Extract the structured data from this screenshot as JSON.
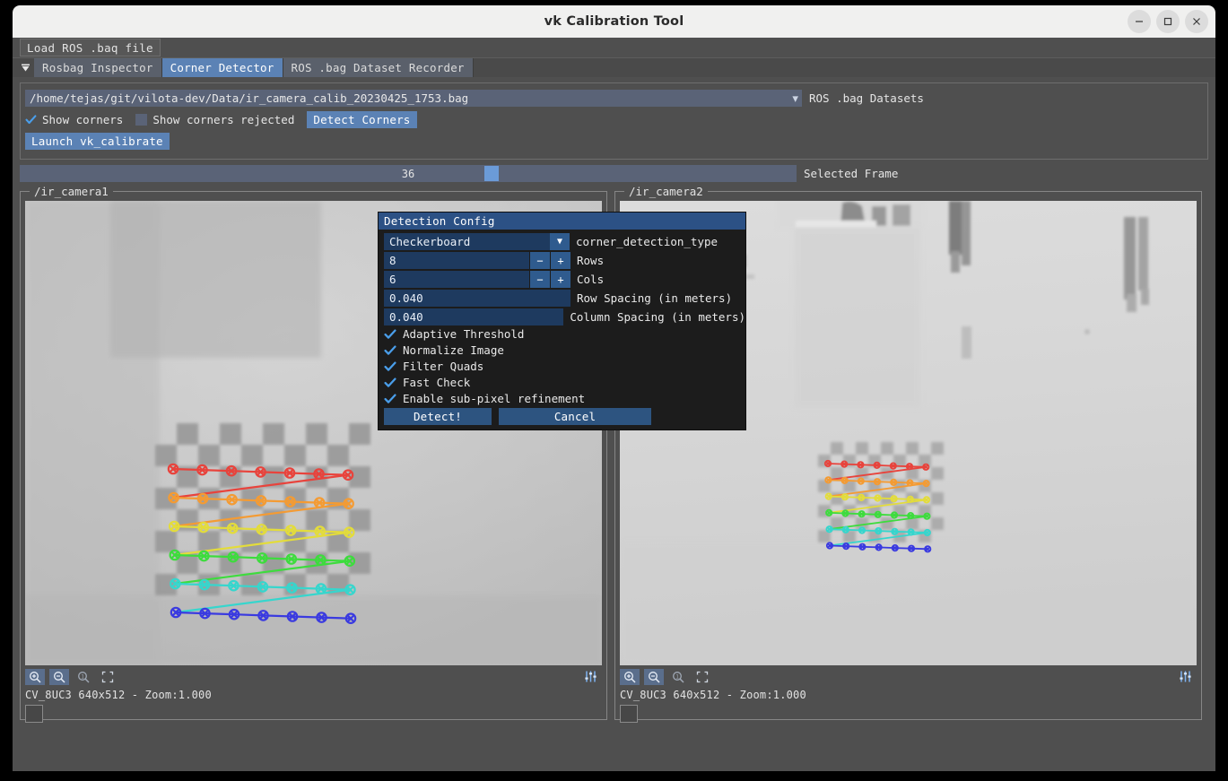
{
  "window": {
    "title": "vk Calibration Tool",
    "minimize_icon": "minimize-icon",
    "maximize_icon": "maximize-icon",
    "close_icon": "close-icon"
  },
  "menubar": {
    "items": [
      {
        "label": "Load ROS .baq file"
      }
    ]
  },
  "tabs": {
    "overflow_icon": "tab-overflow-arrow-icon",
    "items": [
      {
        "label": "Rosbag Inspector",
        "active": false
      },
      {
        "label": "Corner Detector",
        "active": true
      },
      {
        "label": "ROS .bag Dataset Recorder",
        "active": false
      }
    ]
  },
  "config": {
    "dataset_path": "/home/tejas/git/vilota-dev/Data/ir_camera_calib_20230425_1753.bag",
    "dataset_caret": "▼",
    "dataset_label": "ROS .bag Datasets",
    "show_corners": {
      "label": "Show corners",
      "checked": true
    },
    "show_corners_rejected": {
      "label": "Show corners rejected",
      "checked": false
    },
    "detect_corners_button": "Detect Corners",
    "launch_button": "Launch vk_calibrate"
  },
  "frame_slider": {
    "value": "36",
    "label": "Selected Frame",
    "handle_position_percent": 60
  },
  "cameras": [
    {
      "title": "/ir_camera1",
      "status": "CV_8UC3 640x512 - Zoom:1.000",
      "tools": [
        {
          "name": "zoom-in-icon"
        },
        {
          "name": "zoom-out-icon"
        },
        {
          "name": "zoom-actual-size-icon"
        },
        {
          "name": "fit-to-window-icon"
        }
      ],
      "settings_icon": "sliders-icon"
    },
    {
      "title": "/ir_camera2",
      "status": "CV_8UC3 640x512 - Zoom:1.000",
      "tools": [
        {
          "name": "zoom-in-icon"
        },
        {
          "name": "zoom-out-icon"
        },
        {
          "name": "zoom-actual-size-icon"
        },
        {
          "name": "fit-to-window-icon"
        }
      ],
      "settings_icon": "sliders-icon"
    }
  ],
  "detection_dialog": {
    "title": "Detection Config",
    "corner_detection_type": {
      "value": "Checkerboard",
      "label": "corner_detection_type",
      "caret": "▼"
    },
    "rows": {
      "value": "8",
      "label": "Rows",
      "minus": "−",
      "plus": "+"
    },
    "cols": {
      "value": "6",
      "label": "Cols",
      "minus": "−",
      "plus": "+"
    },
    "row_spacing": {
      "value": "0.040",
      "label": "Row Spacing (in meters)"
    },
    "column_spacing": {
      "value": "0.040",
      "label": "Column Spacing (in meters)"
    },
    "checkboxes": [
      {
        "label": "Adaptive Threshold",
        "checked": true
      },
      {
        "label": "Normalize Image",
        "checked": true
      },
      {
        "label": "Filter Quads",
        "checked": true
      },
      {
        "label": "Fast Check",
        "checked": true
      },
      {
        "label": "Enable sub-pixel refinement",
        "checked": true
      }
    ],
    "detect_button": "Detect!",
    "cancel_button": "Cancel"
  },
  "colors": {
    "window_bg": "#4f4f4f",
    "titlebar_bg": "#f0f0ef",
    "accent_blue": "#5b82b5",
    "tab_active": "#5b82b5",
    "dialog_bg": "#1c1c1c",
    "dialog_title": "#2c5185",
    "dialog_input": "#1e3a5f",
    "dialog_button": "#2d5480",
    "slider_track": "#5a6377",
    "slider_handle": "#6b9bd8",
    "checkmark": "#4a9eea"
  },
  "detection_overlay": {
    "row_colors": [
      "#e8433c",
      "#f49b33",
      "#e3dc3b",
      "#3ddc3d",
      "#36d6cd",
      "#3a3ae0"
    ],
    "rows": 6,
    "cols_per_row": 7
  }
}
